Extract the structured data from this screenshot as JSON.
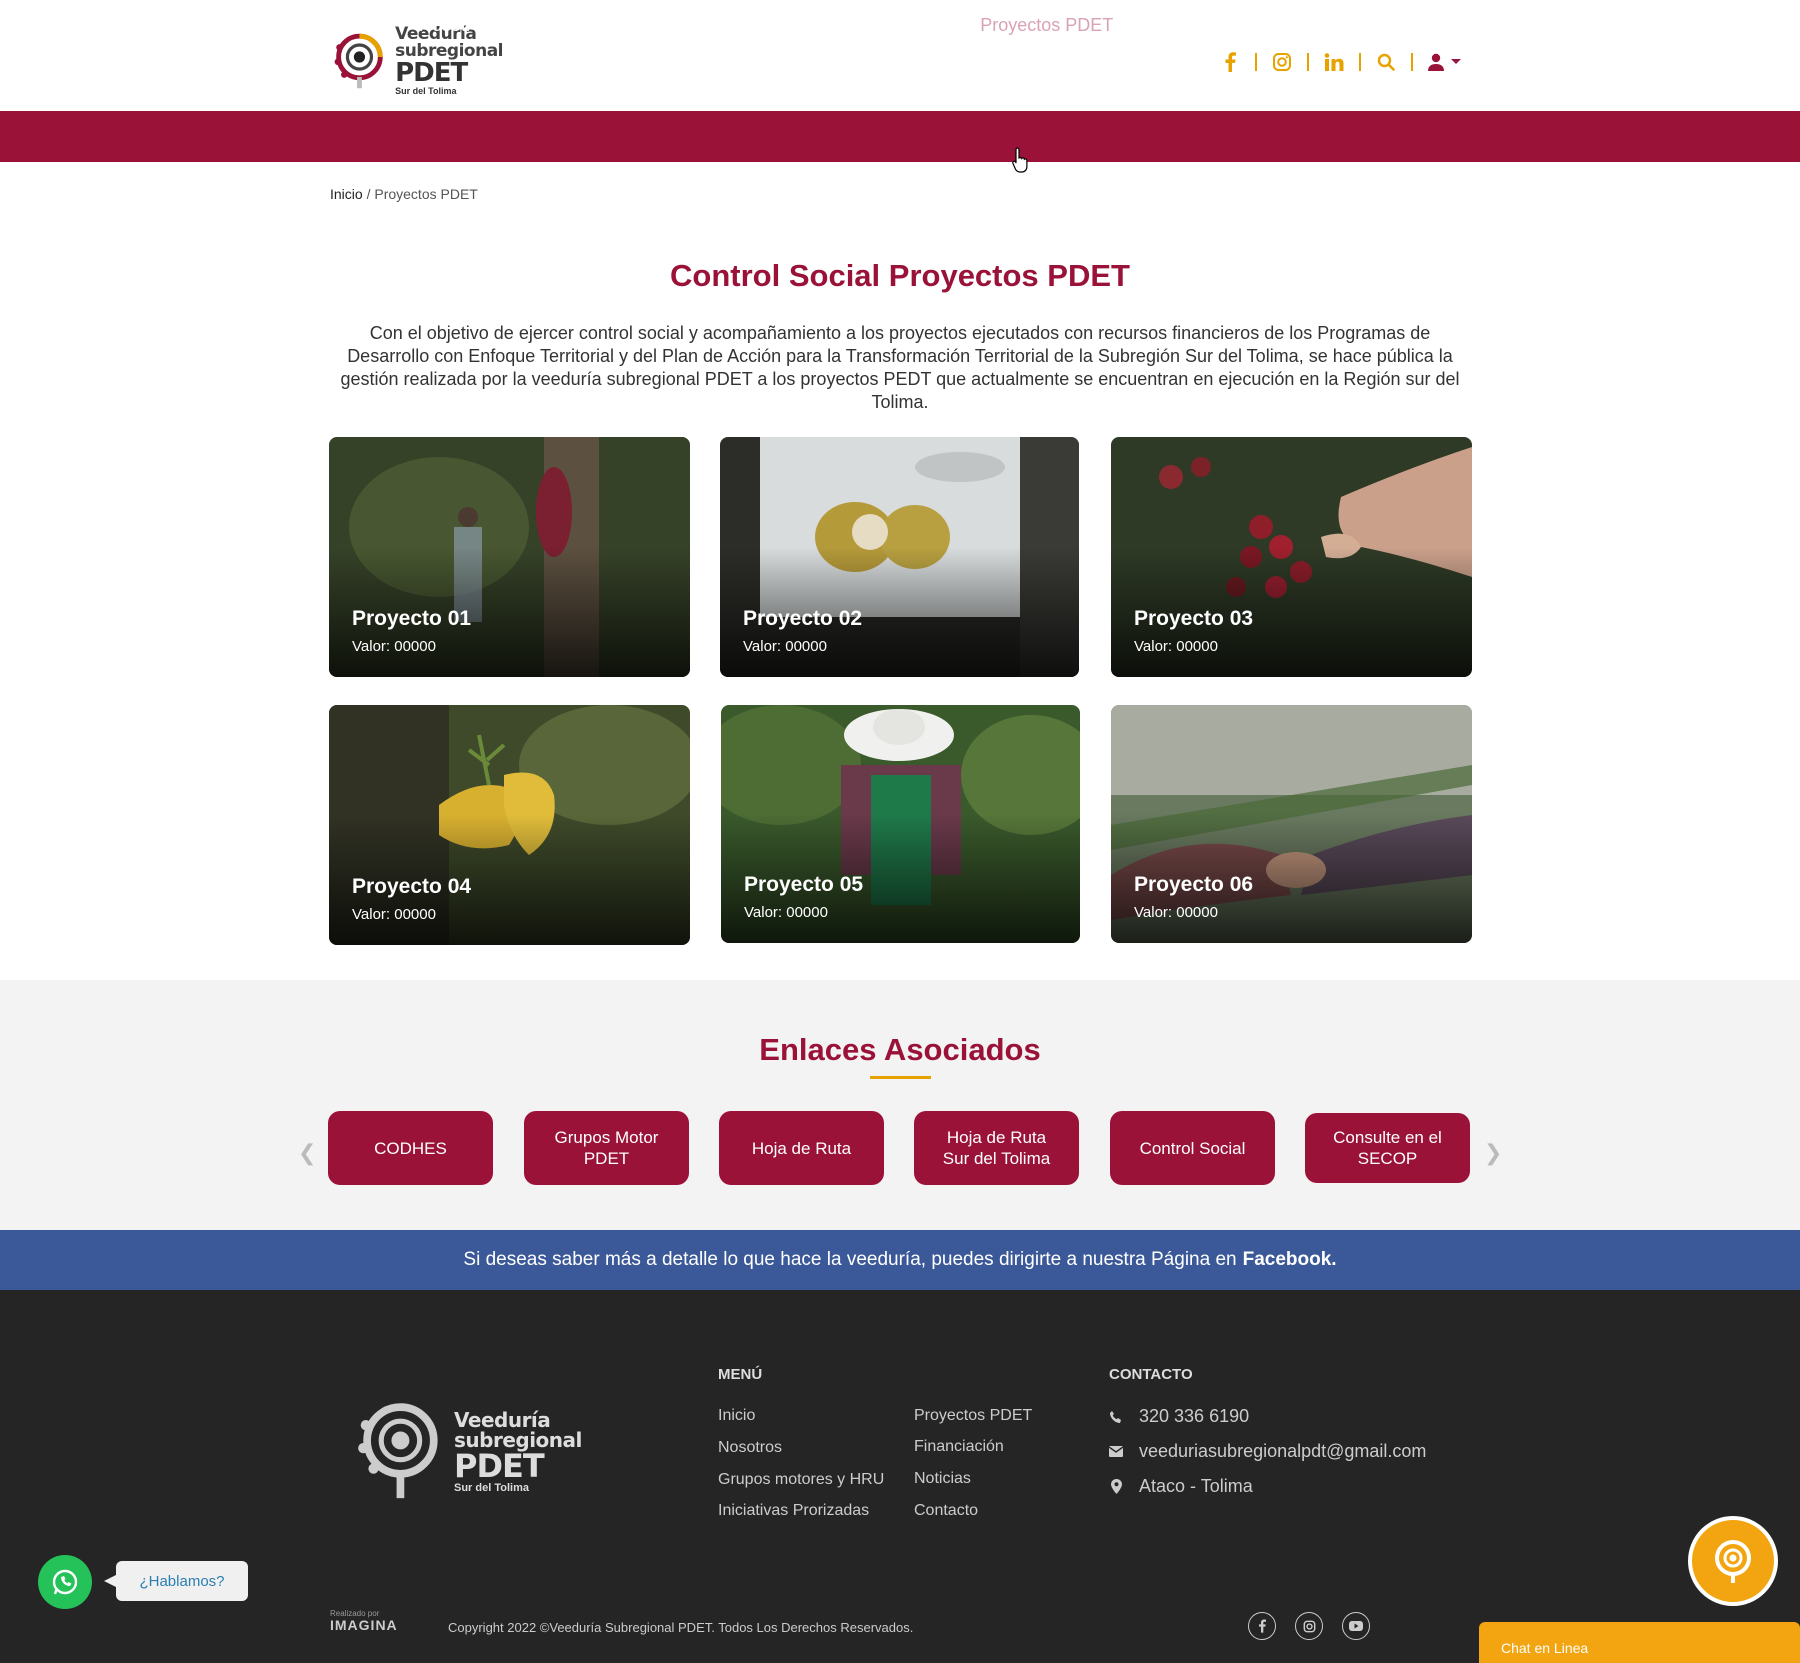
{
  "header": {
    "logo": {
      "line1": "Veeduría",
      "line2": "subregional",
      "line3": "PDET",
      "line4": "Sur del Tolima"
    },
    "social_icons": [
      "facebook-icon",
      "instagram-icon",
      "linkedin-icon",
      "search-icon",
      "user-icon"
    ],
    "accent": "#e8a200"
  },
  "nav": {
    "items": [
      "Inicio",
      "Nosotros",
      "Grupos motores y HRU",
      "Iniciativas Prorizadas",
      "Proyectos PDET",
      "Financiación",
      "Noticias",
      "Contacto"
    ],
    "active": "Proyectos PDET",
    "bg": "#9b1239"
  },
  "breadcrumb": {
    "home": "Inicio",
    "sep": "/",
    "current": "Proyectos PDET"
  },
  "main": {
    "title": "Control Social Proyectos PDET",
    "intro": "Con el objetivo de ejercer control social y acompañamiento a los proyectos ejecutados con recursos financieros de  los Programas de Desarrollo con Enfoque Territorial y del Plan de Acción para la Transformación Territorial de la Subregión Sur del Tolima, se hace pública la gestión realizada por la veeduría subregional PDET a los proyectos PEDT que actualmente se encuentran en ejecución en la Región sur del Tolima."
  },
  "projects": [
    {
      "title": "Proyecto 01",
      "value": "Valor: 00000"
    },
    {
      "title": "Proyecto 02",
      "value": "Valor: 00000"
    },
    {
      "title": "Proyecto 03",
      "value": "Valor: 00000"
    },
    {
      "title": "Proyecto 04",
      "value": "Valor: 00000"
    },
    {
      "title": "Proyecto 05",
      "value": "Valor: 00000"
    },
    {
      "title": "Proyecto 06",
      "value": "Valor: 00000"
    }
  ],
  "enlaces": {
    "title": "Enlaces Asociados",
    "items": [
      "CODHES",
      "Grupos Motor PDET",
      "Hoja de Ruta",
      "Hoja de Ruta Sur del Tolima",
      "Control Social",
      "Consulte en el SECOP"
    ]
  },
  "fb_banner": {
    "text": "Si deseas saber más a detalle lo que hace la veeduría, puedes dirigirte a nuestra Página en",
    "link": "Facebook."
  },
  "footer": {
    "menu_title": "MENÚ",
    "menu_col1": [
      "Inicio",
      "Nosotros",
      "Grupos motores y HRU",
      "Iniciativas Prorizadas"
    ],
    "menu_col2": [
      "Proyectos PDET",
      "Financiación",
      "Noticias",
      "Contacto"
    ],
    "contact_title": "CONTACTO",
    "phone": "320 336 6190",
    "email": "veeduriasubregionalpdt@gmail.com",
    "location": "Ataco - Tolima",
    "made_by_label": "Realizado por",
    "made_by_brand": "IMAGINA",
    "copyright": "Copyright 2022 ©Veeduría Subregional PDET. Todos Los Derechos Reservados.",
    "social_icons": [
      "facebook-icon",
      "instagram-icon",
      "youtube-icon"
    ]
  },
  "floating": {
    "whatsapp_bubble": "¿Hablamos?",
    "chat_bar": "Chat en Linea"
  }
}
